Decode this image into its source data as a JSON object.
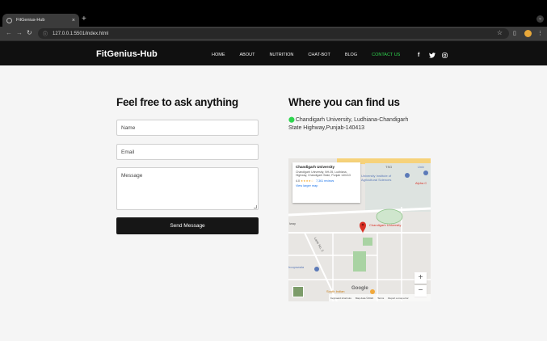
{
  "browser": {
    "tab_title": "FitGenius-Hub",
    "tab_close": "×",
    "new_tab": "+",
    "url": "127.0.0.1:5501/index.html",
    "back_icon": "arrow-left-icon",
    "forward_icon": "arrow-right-icon",
    "reload_icon": "reload-icon"
  },
  "site": {
    "brand": "FitGenius-Hub",
    "nav": [
      "HOME",
      "ABOUT",
      "NUTRITION",
      "CHAT-BOT",
      "BLOG",
      "CONTACT US"
    ],
    "active_nav": "CONTACT US",
    "active_color": "#2fd54f",
    "social": [
      "f",
      "t",
      "ig"
    ]
  },
  "contact": {
    "heading": "Feel free to ask anything",
    "name_placeholder": "Name",
    "email_placeholder": "Email",
    "message_placeholder": "Message",
    "send_label": "Send Message"
  },
  "location": {
    "heading": "Where you can find us",
    "address_line1": "Chandigarh University, Ludhiana-Chandigarh",
    "address_line2": "State Highway,Punjab-140413"
  },
  "map": {
    "place_name": "Chandigarh University",
    "place_address": "Chandigarh University, NH-05, Ludhiana, Highway, Chandigarh State, Punjab 140413",
    "rating": "4.0",
    "stars": "★★★★☆",
    "reviews": "7,361 reviews",
    "view_larger": "View larger map",
    "marker_label": "Chandigarh University",
    "labels": {
      "tsg": "TSG",
      "univ": "Univ",
      "aas": "University Institute of Agricultural Sciences",
      "alpha": "Alpha C",
      "way": "lway",
      "lane": "Lane No. 3",
      "dhoopswala": "hoopswala",
      "south_indian": "South Indian",
      "google": "Google"
    },
    "zoom_in": "+",
    "zoom_out": "−",
    "footer": [
      "Keyboard shortcuts",
      "Map data ©2024",
      "Terms",
      "Report a map error"
    ]
  }
}
